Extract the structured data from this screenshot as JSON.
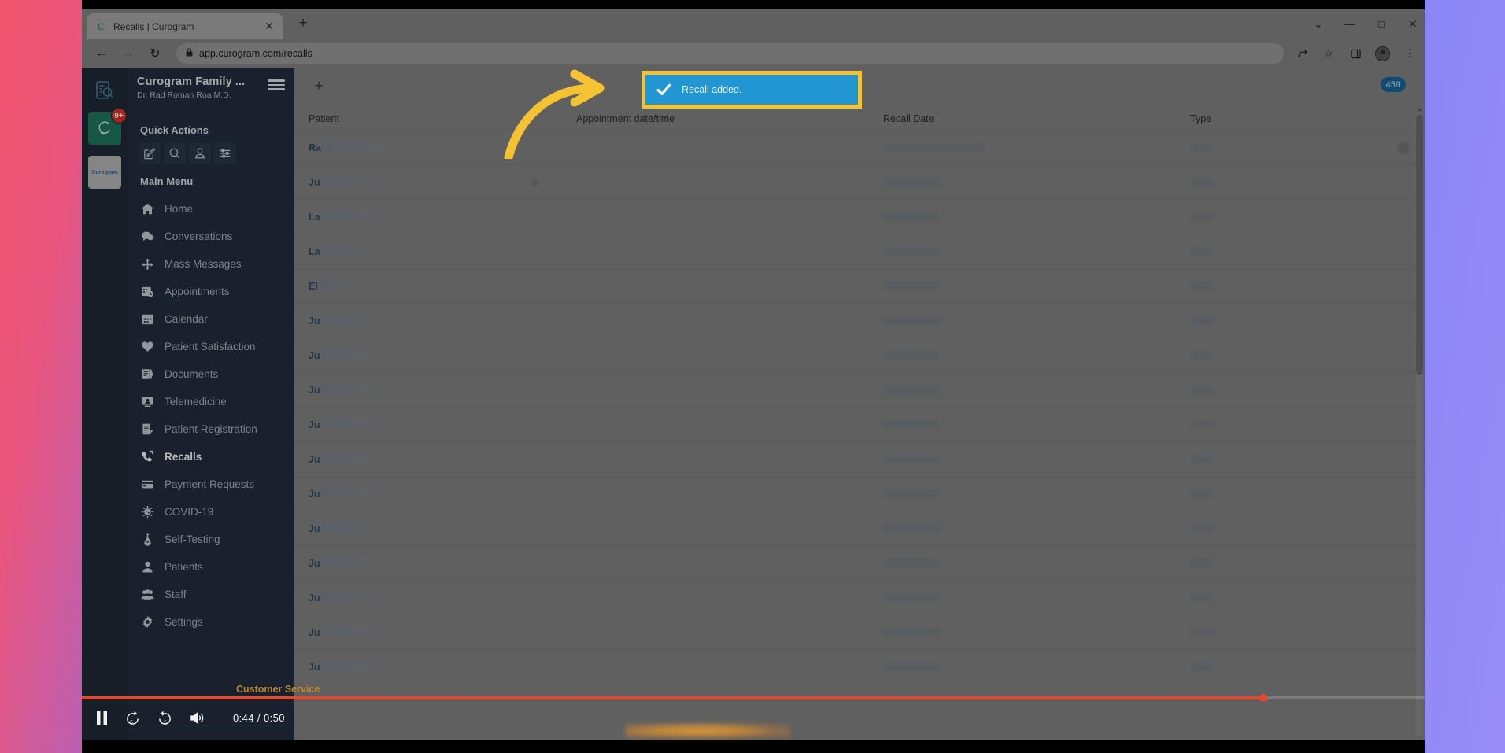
{
  "browser": {
    "tab": {
      "title": "Recalls | Curogram",
      "favicon": "curogram-favicon",
      "close_label": "✕"
    },
    "new_tab_label": "+",
    "window_controls": {
      "minimize": "—",
      "maximize": "□",
      "close": "✕",
      "menu": "⌄"
    },
    "nav": {
      "back": "←",
      "forward": "→",
      "reload": "↻"
    },
    "url": "app.curogram.com/recalls",
    "lock": "🔒",
    "omni_icons": {
      "share": "share-icon",
      "bookmark": "☆",
      "sidepanel": "◫",
      "profile": "avatar",
      "menu": "⋮"
    }
  },
  "rail": {
    "items": [
      {
        "name": "recalls-clipboard-icon",
        "badge": ""
      },
      {
        "name": "curogram-app-icon",
        "badge": "9+"
      }
    ],
    "logo_label": "Curogram"
  },
  "sidebar": {
    "org_name": "Curogram Family ...",
    "user_name": "Dr. Rad Roman Roa M.D.",
    "hamburger": "menu-icon",
    "quick_actions_title": "Quick Actions",
    "quick_actions": [
      {
        "name": "compose-icon",
        "label": "Compose"
      },
      {
        "name": "search-icon",
        "label": "Search"
      },
      {
        "name": "add-patient-icon",
        "label": "Add Patient"
      },
      {
        "name": "filter-icon",
        "label": "Filters"
      }
    ],
    "main_menu_title": "Main Menu",
    "items": [
      {
        "label": "Home",
        "icon": "home-icon",
        "active": false
      },
      {
        "label": "Conversations",
        "icon": "chat-icon",
        "active": false
      },
      {
        "label": "Mass Messages",
        "icon": "broadcast-icon",
        "active": false
      },
      {
        "label": "Appointments",
        "icon": "appointments-icon",
        "active": false
      },
      {
        "label": "Calendar",
        "icon": "calendar-icon",
        "active": false
      },
      {
        "label": "Patient Satisfaction",
        "icon": "heart-icon",
        "active": false
      },
      {
        "label": "Documents",
        "icon": "documents-icon",
        "active": false
      },
      {
        "label": "Telemedicine",
        "icon": "telemedicine-icon",
        "active": false
      },
      {
        "label": "Patient Registration",
        "icon": "registration-icon",
        "active": false
      },
      {
        "label": "Recalls",
        "icon": "recall-phone-icon",
        "active": true
      },
      {
        "label": "Payment Requests",
        "icon": "card-icon",
        "active": false
      },
      {
        "label": "COVID-19",
        "icon": "virus-icon",
        "active": false
      },
      {
        "label": "Self-Testing",
        "icon": "test-tube-icon",
        "active": false
      },
      {
        "label": "Patients",
        "icon": "person-icon",
        "active": false
      },
      {
        "label": "Staff",
        "icon": "staff-icon",
        "active": false
      },
      {
        "label": "Settings",
        "icon": "gear-icon",
        "active": false
      }
    ]
  },
  "main": {
    "add_button_label": "+",
    "count_badge": "459",
    "columns": [
      "Patient",
      "Appointment date/time",
      "Recall Date",
      "Type"
    ],
    "rows": [
      {
        "patient_prefix": "Ra",
        "name_width": 98,
        "appt": "",
        "recall_width": 130,
        "type_width": 30,
        "has_avatar": true
      },
      {
        "patient_prefix": "Ju",
        "name_width": 74,
        "appt": "dot",
        "recall_width": 72,
        "type_width": 30,
        "has_avatar": false
      },
      {
        "patient_prefix": "La",
        "name_width": 78,
        "appt": "",
        "recall_width": 72,
        "type_width": 30,
        "has_avatar": false
      },
      {
        "patient_prefix": "La",
        "name_width": 66,
        "appt": "",
        "recall_width": 72,
        "type_width": 30,
        "has_avatar": false
      },
      {
        "patient_prefix": "El",
        "name_width": 56,
        "appt": "",
        "recall_width": 72,
        "type_width": 30,
        "has_avatar": false
      },
      {
        "patient_prefix": "Ju",
        "name_width": 76,
        "appt": "",
        "recall_width": 72,
        "type_width": 30,
        "has_avatar": false
      },
      {
        "patient_prefix": "Ju",
        "name_width": 76,
        "appt": "",
        "recall_width": 72,
        "type_width": 30,
        "has_avatar": false
      },
      {
        "patient_prefix": "Ju",
        "name_width": 80,
        "appt": "",
        "recall_width": 72,
        "type_width": 30,
        "has_avatar": false
      },
      {
        "patient_prefix": "Ju",
        "name_width": 76,
        "appt": "",
        "recall_width": 72,
        "type_width": 30,
        "has_avatar": false
      },
      {
        "patient_prefix": "Ju",
        "name_width": 72,
        "appt": "",
        "recall_width": 72,
        "type_width": 30,
        "has_avatar": false
      },
      {
        "patient_prefix": "Ju",
        "name_width": 76,
        "appt": "",
        "recall_width": 72,
        "type_width": 30,
        "has_avatar": false
      },
      {
        "patient_prefix": "Ju",
        "name_width": 74,
        "appt": "",
        "recall_width": 72,
        "type_width": 30,
        "has_avatar": false
      },
      {
        "patient_prefix": "Ju",
        "name_width": 76,
        "appt": "",
        "recall_width": 72,
        "type_width": 30,
        "has_avatar": false
      },
      {
        "patient_prefix": "Ju",
        "name_width": 74,
        "appt": "",
        "recall_width": 72,
        "type_width": 30,
        "has_avatar": false
      },
      {
        "patient_prefix": "Ju",
        "name_width": 76,
        "appt": "",
        "recall_width": 72,
        "type_width": 30,
        "has_avatar": false
      },
      {
        "patient_prefix": "Ju",
        "name_width": 74,
        "appt": "",
        "recall_width": 72,
        "type_width": 30,
        "has_avatar": false
      }
    ]
  },
  "toast": {
    "message": "Recall added.",
    "icon": "check-icon",
    "background_color": "#2196d3",
    "highlight_color": "#f5c233"
  },
  "annotation": {
    "arrow": "curved-arrow-pointing-right",
    "color": "#f5c233"
  },
  "video_player": {
    "play_state_icon": "pause-icon",
    "rewind_label": "5",
    "forward_label": "5",
    "volume_icon": "volume-icon",
    "current_time": "0:44",
    "separator": "/",
    "duration": "0:50",
    "progress_percent": 88,
    "caption": "Customer Service"
  }
}
